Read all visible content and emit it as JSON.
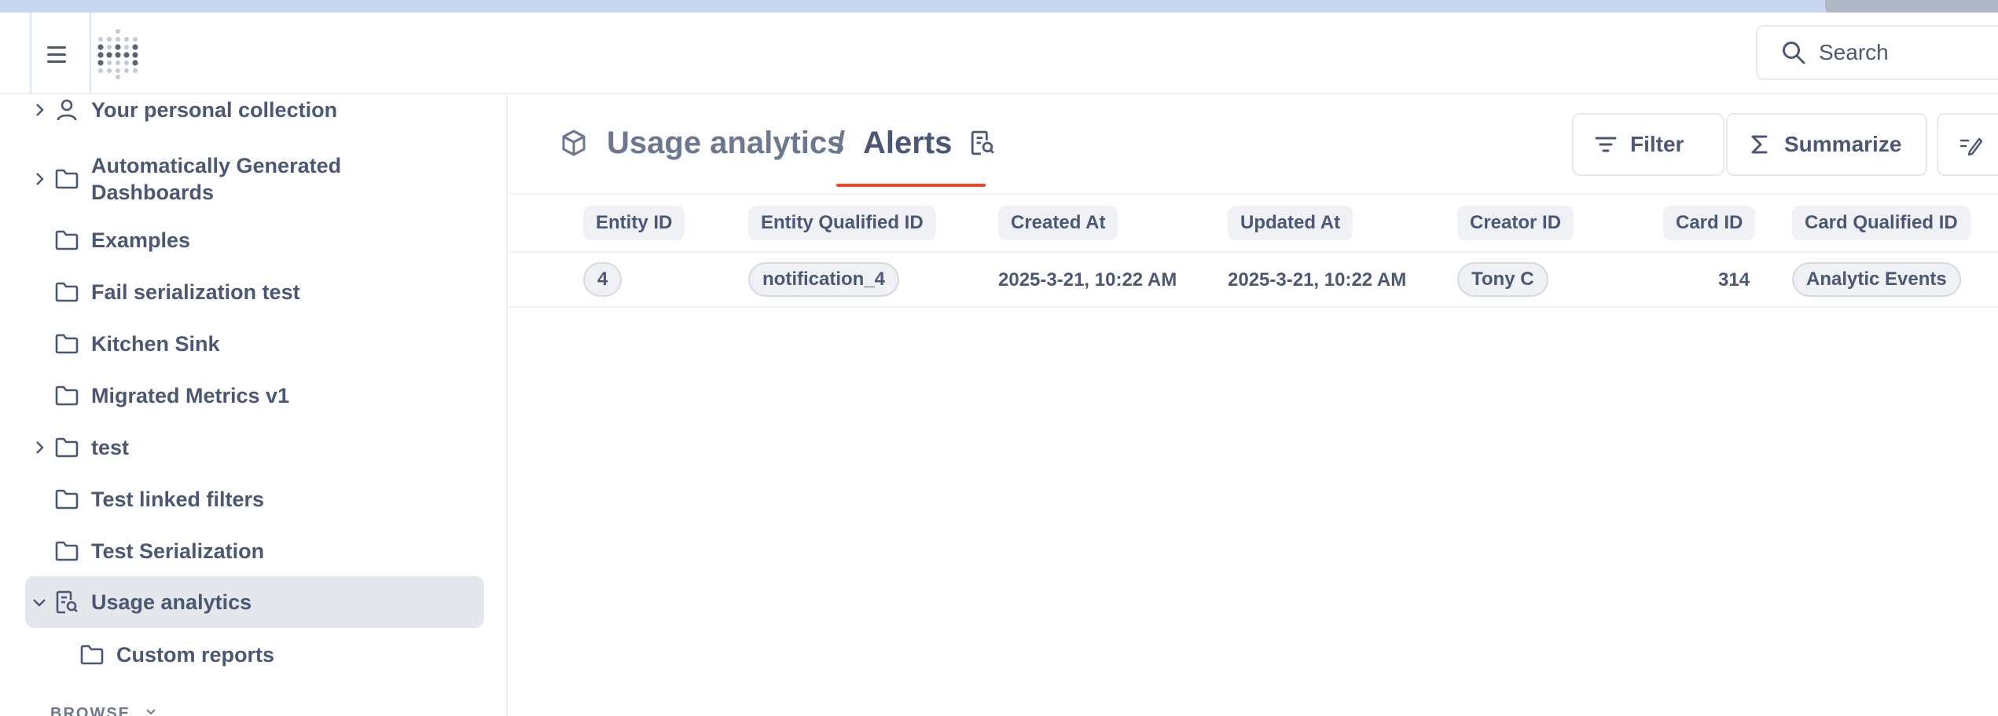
{
  "search": {
    "placeholder": "Search"
  },
  "sidebar": {
    "items": [
      {
        "label": "Your personal collection",
        "icon": "person-icon",
        "chevron": "right"
      },
      {
        "label": "Automatically Generated",
        "label2": "Dashboards",
        "icon": "folder-icon",
        "chevron": "right"
      },
      {
        "label": "Examples",
        "icon": "folder-icon",
        "chevron": ""
      },
      {
        "label": "Fail serialization test",
        "icon": "folder-icon",
        "chevron": ""
      },
      {
        "label": "Kitchen Sink",
        "icon": "folder-icon",
        "chevron": ""
      },
      {
        "label": "Migrated Metrics v1",
        "icon": "folder-icon",
        "chevron": ""
      },
      {
        "label": "test",
        "icon": "folder-icon",
        "chevron": "right"
      },
      {
        "label": "Test linked filters",
        "icon": "folder-icon",
        "chevron": ""
      },
      {
        "label": "Test Serialization",
        "icon": "folder-icon",
        "chevron": ""
      },
      {
        "label": "Usage analytics",
        "icon": "audit-collection-icon",
        "chevron": "down",
        "active": true
      },
      {
        "label": "Custom reports",
        "icon": "folder-icon",
        "chevron": "",
        "child": true
      }
    ],
    "browse_label": "BROWSE"
  },
  "header": {
    "collection": "Usage analytics",
    "separator": "/",
    "title": "Alerts",
    "filter_label": "Filter",
    "summarize_label": "Summarize"
  },
  "table": {
    "columns": [
      "Entity ID",
      "Entity Qualified ID",
      "Created At",
      "Updated At",
      "Creator ID",
      "Card ID",
      "Card Qualified ID"
    ],
    "rows": [
      [
        "4",
        "notification_4",
        "2025-3-21, 10:22 AM",
        "2025-3-21, 10:22 AM",
        "Tony C",
        "314",
        "Analytic Events"
      ]
    ]
  },
  "colors": {
    "text": "#4c5773",
    "text_muted": "#6d7790",
    "active_bg": "#e4e7ec",
    "accent_underline": "#ea4a29",
    "border": "#eef0f3"
  }
}
